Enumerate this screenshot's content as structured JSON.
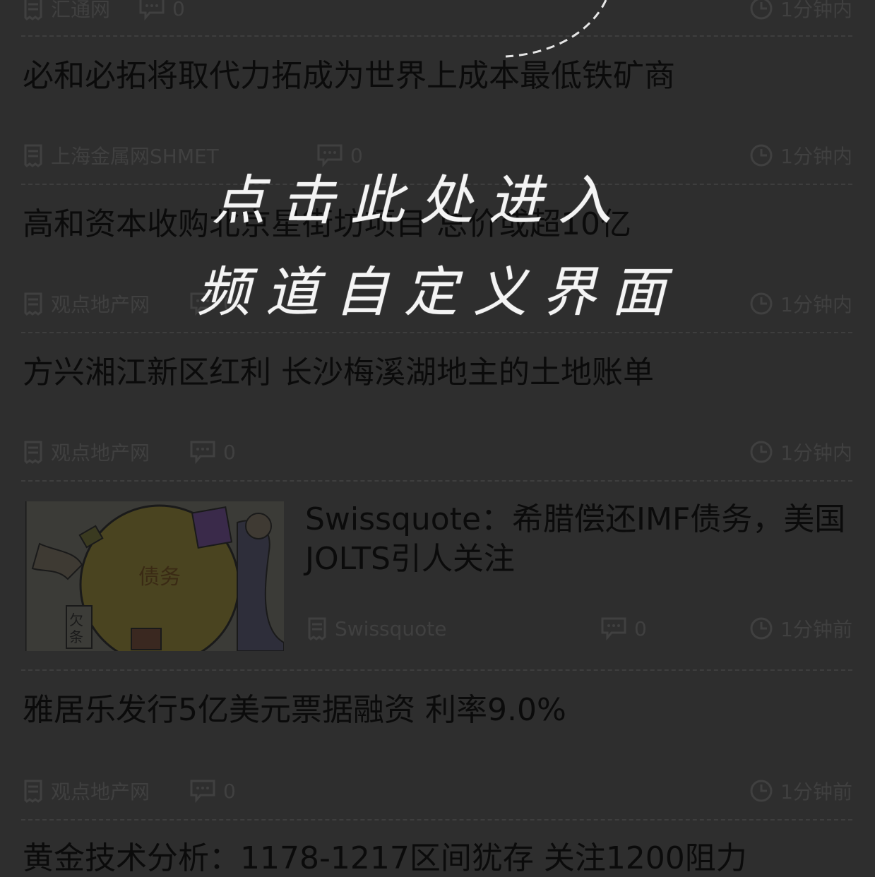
{
  "hint": {
    "line1": "点击此处进入",
    "line2": "频道自定义界面"
  },
  "items": [
    {
      "title": "",
      "source": "汇通网",
      "comments": "0",
      "time": "1分钟内"
    },
    {
      "title": "必和必拓将取代力拓成为世界上成本最低铁矿商",
      "source": "上海金属网SHMET",
      "comments": "0",
      "time": "1分钟内"
    },
    {
      "title": "高和资本收购北京星街坊项目 总价或超10亿",
      "source": "观点地产网",
      "comments": "0",
      "time": "1分钟内"
    },
    {
      "title": "方兴湘江新区红利 长沙梅溪湖地主的土地账单",
      "source": "观点地产网",
      "comments": "0",
      "time": "1分钟内"
    },
    {
      "title": "Swissquote：希腊偿还IMF债务，美国JOLTS引人关注",
      "source": "Swissquote",
      "comments": "0",
      "time": "1分钟前",
      "image_label": "债务",
      "image_tag": "欠条"
    },
    {
      "title": "雅居乐发行5亿美元票据融资 利率9.0%",
      "source": "观点地产网",
      "comments": "0",
      "time": "1分钟前"
    },
    {
      "title": "黄金技术分析：1178-1217区间犹存 关注1200阻力",
      "source": "",
      "comments": "",
      "time": ""
    }
  ],
  "colors": {
    "background": "#2e2e2e",
    "title_text": "#0b0b0b",
    "meta_text": "#404040",
    "hint_text": "#f4f4f4"
  },
  "icons": {
    "source": "source-doc-icon",
    "comments": "comment-bubble-icon",
    "time": "clock-icon"
  }
}
